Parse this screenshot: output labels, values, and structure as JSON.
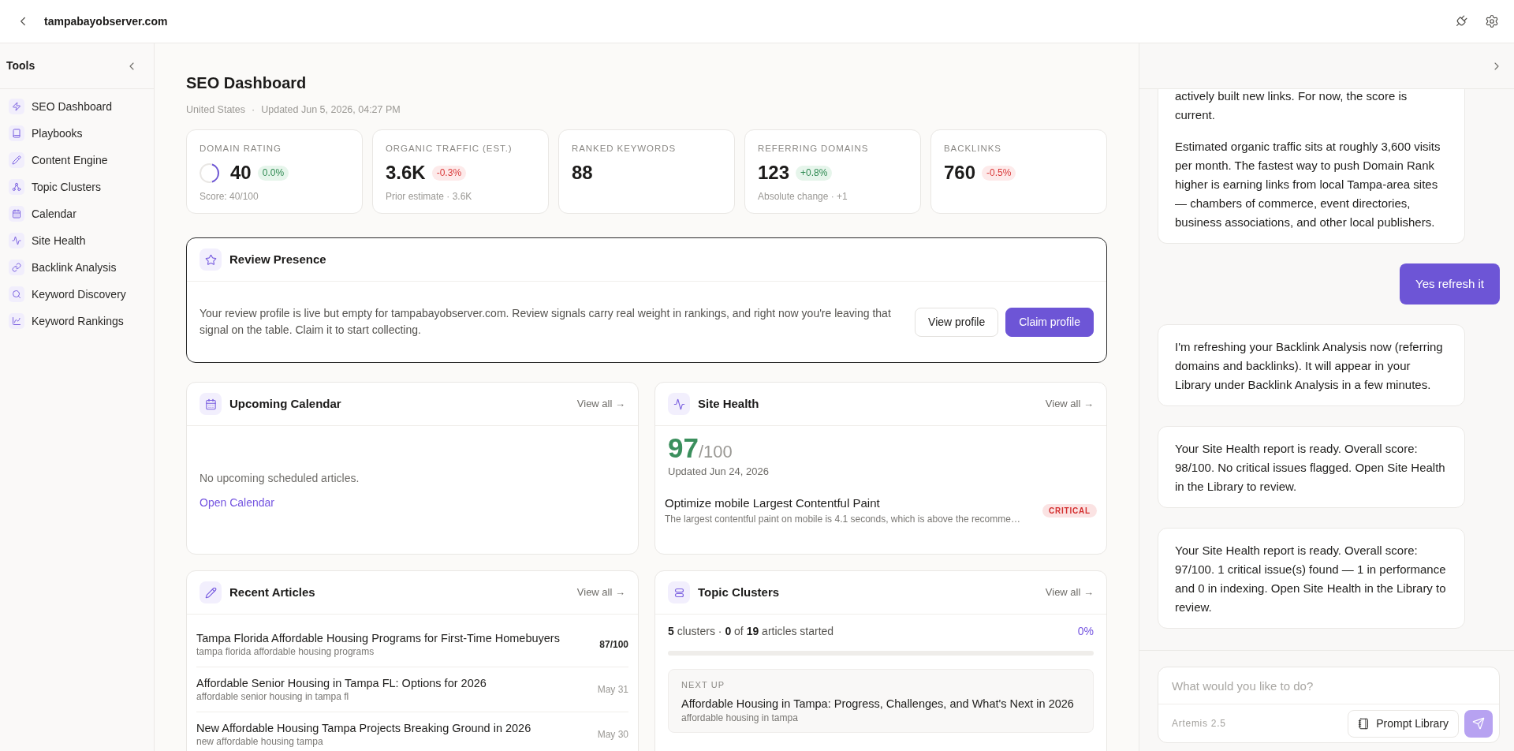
{
  "header": {
    "title": "tampabayobserver.com"
  },
  "sidebar": {
    "title": "Tools",
    "items": [
      "SEO Dashboard",
      "Playbooks",
      "Content Engine",
      "Topic Clusters",
      "Calendar",
      "Site Health",
      "Backlink Analysis",
      "Keyword Discovery",
      "Keyword Rankings"
    ]
  },
  "dashboard": {
    "title": "SEO Dashboard",
    "meta": [
      "United States",
      "Updated Jun 5, 2026, 04:27 PM"
    ],
    "separator": "·",
    "metrics": [
      {
        "label": "DOMAIN RATING",
        "value": "40",
        "delta": "0.0%",
        "kind": "up",
        "note": "Score: 40/100",
        "level": 0.4
      },
      {
        "label": "ORGANIC TRAFFIC (EST.)",
        "value": "3.6K",
        "delta": "-0.3%",
        "kind": "down",
        "note": "Prior estimate · 3.6K"
      },
      {
        "label": "RANKED KEYWORDS",
        "value": "88"
      },
      {
        "label": "REFERRING DOMAINS",
        "value": "123",
        "delta": "+0.8%",
        "kind": "up",
        "note": "Absolute change · +1"
      },
      {
        "label": "BACKLINKS",
        "value": "760",
        "delta": "-0.5%",
        "kind": "down"
      }
    ]
  },
  "review_presence": {
    "title": "Review Presence",
    "text": "Your review profile is live but empty for tampabayobserver.com. Review signals carry real weight in rankings, and right now you're leaving that signal on the table. Claim it to start collecting.",
    "buttons": [
      {
        "label": "View profile",
        "kind": "secondary"
      },
      {
        "label": "Claim profile",
        "kind": "primary"
      }
    ]
  },
  "upcoming_calendar": {
    "title": "Upcoming Calendar",
    "link": "View all →",
    "empty_text": "No upcoming scheduled articles.",
    "action": "Open Calendar"
  },
  "site_health": {
    "title": "Site Health",
    "link": "View all →",
    "score": "97",
    "score_max": "/100",
    "updated": "Updated Jun 24, 2026",
    "issues": [
      {
        "title": "Optimize mobile Largest Contentful Paint",
        "description": "The largest contentful paint on mobile is 4.1 seconds, which is above the recomme…",
        "severity": "CRITICAL"
      }
    ]
  },
  "recent_articles": {
    "title": "Recent Articles",
    "link": "View all →",
    "items": [
      {
        "title": "Tampa Florida Affordable Housing Programs for First-Time Homebuyers",
        "keyword": "tampa florida affordable housing programs",
        "meta": "87/100",
        "kind": "score"
      },
      {
        "title": "Affordable Senior Housing in Tampa FL: Options for 2026",
        "keyword": "affordable senior housing in tampa fl",
        "meta": "May 31",
        "kind": "date"
      },
      {
        "title": "New Affordable Housing Tampa Projects Breaking Ground in 2026",
        "keyword": "new affordable housing tampa",
        "meta": "May 30",
        "kind": "date"
      }
    ]
  },
  "topic_clusters": {
    "title": "Topic Clusters",
    "link": "View all →",
    "summary": "**5** clusters · **0** of **19** articles started",
    "percent": "0%",
    "next_up": {
      "label": "NEXT UP",
      "title": "Affordable Housing in Tampa: Progress, Challenges, and What's Next in 2026",
      "keyword": "affordable housing in tampa"
    }
  },
  "chat": {
    "messages": [
      {
        "kind": "assistant",
        "paragraphs": [
          "actively built new links. For now, the score is current.",
          "Estimated organic traffic sits at roughly 3,600 visits per month. The fastest way to push Domain Rank higher is earning links from local Tampa-area sites — chambers of commerce, event directories, business associations, and other local publishers."
        ]
      },
      {
        "kind": "user",
        "paragraphs": [
          "Yes refresh it"
        ]
      },
      {
        "kind": "assistant",
        "paragraphs": [
          "I'm refreshing your Backlink Analysis now (referring domains and backlinks). It will appear in your Library under Backlink Analysis in a few minutes."
        ]
      },
      {
        "kind": "assistant",
        "paragraphs": [
          "Your Site Health report is ready. Overall score: 98/100. No critical issues flagged. Open Site Health in the Library to review."
        ]
      },
      {
        "kind": "assistant",
        "paragraphs": [
          "Your Site Health report is ready. Overall score: 97/100. 1 critical issue(s) found — 1 in performance and 0 in indexing. Open Site Health in the Library to review."
        ]
      }
    ],
    "composer": {
      "placeholder": "What would you like to do?",
      "model": "Artemis 2.5",
      "library_button": "Prompt Library",
      "send_disabled": true
    }
  }
}
